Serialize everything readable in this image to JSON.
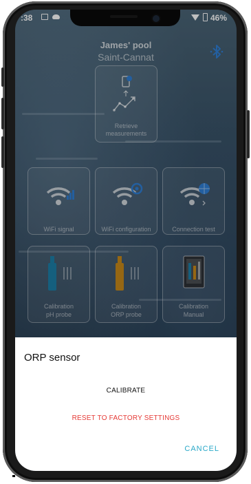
{
  "status_bar": {
    "time": ":38",
    "battery": "46%"
  },
  "header": {
    "pool_name": "James' pool",
    "location": "Saint-Cannat"
  },
  "icons": {
    "bluetooth": "bluetooth-icon",
    "retrieve": "retrieve-measurements-icon"
  },
  "tiles": {
    "retrieve": "Retrieve\nmeasurements",
    "wifi_signal": "WiFi signal",
    "wifi_config": "WiFi configuration",
    "connection_test": "Connection test",
    "calib_ph_1": "Calibration",
    "calib_ph_2": "pH probe",
    "calib_orp_1": "Calibration",
    "calib_orp_2": "ORP probe",
    "calib_manual_1": "Calibration",
    "calib_manual_2": "Manual"
  },
  "sheet": {
    "title": "ORP sensor",
    "calibrate": "CALIBRATE",
    "reset": "RESET TO FACTORY SETTINGS",
    "cancel": "CANCEL"
  },
  "colors": {
    "accent": "#29a8c8",
    "danger": "#e53935",
    "bluetooth": "#2f7fd6"
  }
}
